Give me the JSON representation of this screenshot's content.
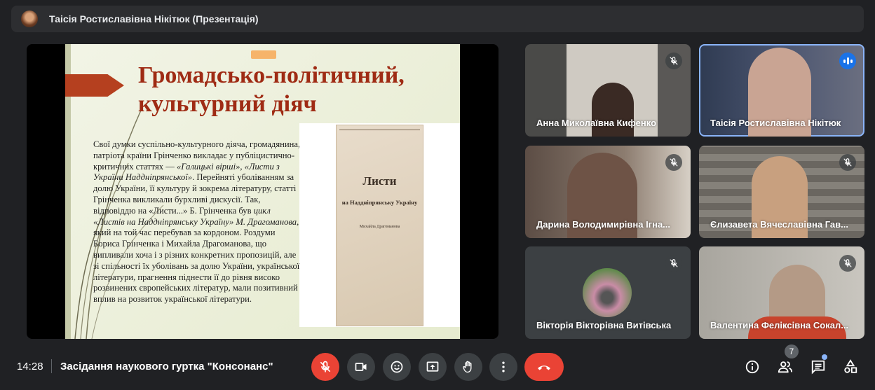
{
  "header": {
    "presenter_title": "Таісія Ростиславівна Нікітюк (Презентація)"
  },
  "slide": {
    "title_line1": "Громадсько-політичний,",
    "title_line2": "культурний діяч",
    "body_p1": "Свої думки суспільно-культурного діяча, громадянина, патріота країни Грінченко викладає у публіцистично-критичних статтях — ",
    "body_i1": "«Галицькі вірші», «Листи з України Наддніпрянської»",
    "body_p2": ". Перейняті уболіванням за долю України, її культуру й зокрема літературу, статті Грінченка викликали бурхливі дискусії. Так, відповіддю на «Листи...» Б. Грінченка був ",
    "body_i2": "цикл «Листів на Наддніпрянську Україну» М. Драгоманова",
    "body_p3": ", який на той час перебував за кордоном. Роздуми Бориса Грінченка і Михайла Драгоманова, що випливали хоча і з різних конкретних пропозицій, але зі спільності їх уболівань за долю України, української літератури, прагнення піднести її до рівня високо розвинених європейських літератур, мали позитивний вплив на розвиток української літератури.",
    "book_title": "Листи",
    "book_subtitle": "на Наддніпрянську Україну",
    "book_author": "Михайла Драгоманова"
  },
  "participants": [
    {
      "name": "Анна Миколаївна Кифенко",
      "muted": true
    },
    {
      "name": "Таісія Ростиславівна Нікітюк",
      "muted": false,
      "speaking": true
    },
    {
      "name": "Дарина Володимирівна Ігна...",
      "muted": true
    },
    {
      "name": "Єлизавета Вячеславівна Гав...",
      "muted": true
    },
    {
      "name": "Вікторія Вікторівна Витівська",
      "muted": true
    },
    {
      "name": "Валентина Феліксівна Сокал...",
      "muted": true
    }
  ],
  "bottombar": {
    "time": "14:28",
    "meeting_name": "Засідання наукового гуртка \"Консонанс\"",
    "participant_count": "7"
  },
  "colors": {
    "background": "#202124",
    "danger": "#ea4335",
    "accent": "#1a73e8",
    "slide_title": "#9f2b14"
  }
}
